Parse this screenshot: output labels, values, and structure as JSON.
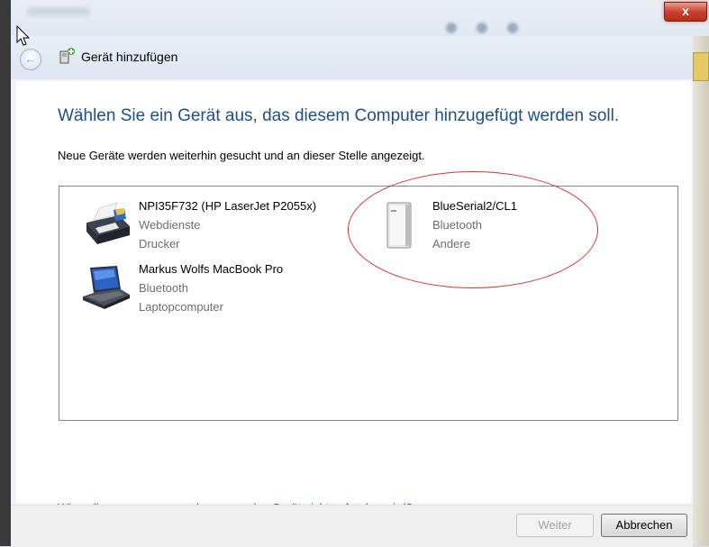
{
  "window": {
    "title": "Gerät hinzufügen",
    "close_label": "x"
  },
  "main": {
    "heading": "Wählen Sie ein Gerät aus, das diesem Computer hinzugefügt werden soll.",
    "subtext": "Neue Geräte werden weiterhin gesucht und an dieser Stelle angezeigt."
  },
  "devices": [
    {
      "name": "NPI35F732 (HP LaserJet P2055x)",
      "line2": "Webdienste",
      "line3": "Drucker",
      "icon": "printer-icon"
    },
    {
      "name": "BlueSerial2/CL1",
      "line2": "Bluetooth",
      "line3": "Andere",
      "icon": "generic-device-icon"
    },
    {
      "name": "Markus Wolfs MacBook Pro",
      "line2": "Bluetooth",
      "line3": "Laptopcomputer",
      "icon": "laptop-icon"
    }
  ],
  "help_link": "Wie soll vorgegangen werden, wenn das Gerät nicht gefunden wird?",
  "buttons": {
    "next": "Weiter",
    "cancel": "Abbrechen"
  },
  "colors": {
    "heading": "#1e4e8c",
    "link": "#1a5fb4",
    "annotation": "#d23a32"
  }
}
